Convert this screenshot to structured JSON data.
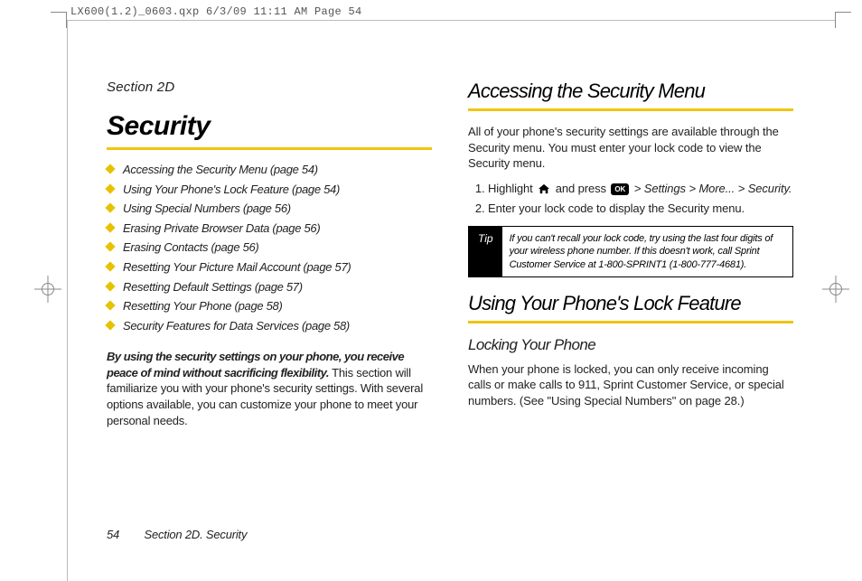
{
  "slug": "LX600(1.2)_0603.qxp  6/3/09  11:11 AM  Page 54",
  "left": {
    "section_label": "Section 2D",
    "title": "Security",
    "toc": [
      "Accessing the Security Menu (page 54)",
      "Using Your Phone's Lock Feature (page 54)",
      "Using Special Numbers (page 56)",
      "Erasing Private Browser Data (page 56)",
      "Erasing Contacts (page 56)",
      "Resetting Your Picture Mail Account (page 57)",
      "Resetting Default Settings (page 57)",
      "Resetting Your Phone (page 58)",
      "Security Features for Data Services (page 58)"
    ],
    "intro_lead": "By using the security settings on your phone, you receive peace of mind without sacrificing flexibility.",
    "intro_rest": " This section will familiarize you with your phone's security settings. With several options available, you can customize your phone to meet your personal needs."
  },
  "right": {
    "h1a": "Accessing the Security Menu",
    "p1": "All of your phone's security settings are available through the Security menu. You must enter your lock code to view the Security menu.",
    "step1_a": "Highlight ",
    "step1_b": " and press ",
    "step1_path": " > Settings > More... > Security.",
    "step2": "Enter your lock code to display the Security menu.",
    "tip_label": "Tip",
    "tip_body": "If you can't recall your lock code, try using the last four digits of your wireless phone number. If this doesn't work, call Sprint Customer Service at 1-800-SPRINT1 (1-800-777-4681).",
    "h1b": "Using Your Phone's Lock Feature",
    "h2a": "Locking Your Phone",
    "p2": "When your phone is locked, you can only receive incoming calls or make calls to 911, Sprint Customer Service, or special numbers. (See \"Using Special Numbers\" on page 28.)"
  },
  "footer": {
    "page": "54",
    "label": "Section 2D. Security"
  },
  "icons": {
    "home": "home-icon",
    "ok": "OK"
  }
}
